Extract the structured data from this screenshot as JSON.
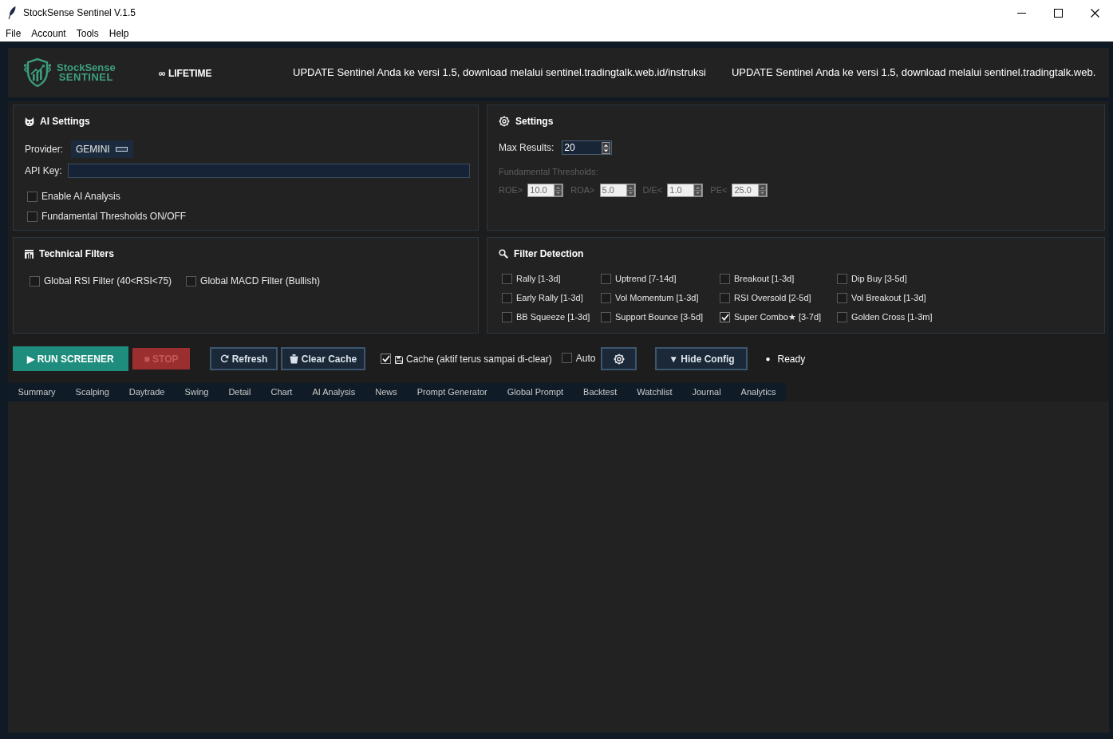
{
  "window": {
    "title": "StockSense Sentinel V.1.5",
    "menu": [
      "File",
      "Account",
      "Tools",
      "Help"
    ]
  },
  "header": {
    "logo": [
      "StockSense",
      "SENTINEL"
    ],
    "license": "∞ LIFETIME",
    "ticker": [
      "UPDATE Sentinel Anda ke versi 1.5, download melalui sentinel.tradingtalk.web.id/instruksi",
      "UPDATE Sentinel Anda ke versi 1.5, download melalui sentinel.tradingtalk.web."
    ]
  },
  "ai_settings": {
    "title": "AI Settings",
    "provider": {
      "label": "Provider:",
      "value": "GEMINI"
    },
    "api_key": {
      "label": "API Key:"
    },
    "options": [
      {
        "label": "Enable AI Analysis",
        "checked": false
      },
      {
        "label": "Fundamental Thresholds ON/OFF",
        "checked": false
      }
    ]
  },
  "settings": {
    "title": "Settings",
    "max_results": {
      "label": "Max Results:",
      "value": "20"
    },
    "thresholds": {
      "label": "Fundamental Thresholds:",
      "disabled": true,
      "fields": [
        {
          "label": "ROE>",
          "value": "10.0"
        },
        {
          "label": "ROA>",
          "value": "5.0"
        },
        {
          "label": "D/E<",
          "value": "1.0"
        },
        {
          "label": "PE<",
          "value": "25.0"
        }
      ]
    }
  },
  "technical_filters": {
    "title": "Technical Filters",
    "options": [
      {
        "label": "Global RSI Filter (40<RSI<75)",
        "checked": false
      },
      {
        "label": "Global MACD Filter (Bullish)",
        "checked": false
      }
    ]
  },
  "filter_detection": {
    "title": "Filter Detection",
    "options": [
      {
        "label": "Rally [1-3d]",
        "checked": false
      },
      {
        "label": "Uptrend [7-14d]",
        "checked": false
      },
      {
        "label": "Breakout [1-3d]",
        "checked": false
      },
      {
        "label": "Dip Buy [3-5d]",
        "checked": false
      },
      {
        "label": "Early Rally [1-3d]",
        "checked": false
      },
      {
        "label": "Vol Momentum [1-3d]",
        "checked": false
      },
      {
        "label": "RSI Oversold [2-5d]",
        "checked": false
      },
      {
        "label": "Vol Breakout [1-3d]",
        "checked": false
      },
      {
        "label": "BB Squeeze [1-3d]",
        "checked": false
      },
      {
        "label": "Support Bounce [3-5d]",
        "checked": false
      },
      {
        "label": "Super Combo★ [3-7d]",
        "checked": true
      },
      {
        "label": "Golden Cross [1-3m]",
        "checked": false
      }
    ]
  },
  "toolbar": {
    "run": {
      "label": "▶ RUN SCREENER"
    },
    "stop": {
      "label": "■ STOP",
      "disabled": true
    },
    "refresh": {
      "label": "Refresh"
    },
    "clear_cache": {
      "label": "Clear Cache"
    },
    "cache": {
      "label": "Cache (aktif terus sampai di-clear)",
      "checked": true
    },
    "auto": {
      "label": "Auto",
      "checked": false
    },
    "hide_config": {
      "label": "▼ Hide Config"
    },
    "status": {
      "dot": "●",
      "text": "Ready"
    }
  },
  "tabs": [
    {
      "label": "Summary",
      "selected": false
    },
    {
      "label": "Scalping",
      "selected": false
    },
    {
      "label": "Daytrade",
      "selected": false
    },
    {
      "label": "Swing",
      "selected": false
    },
    {
      "label": "Detail",
      "selected": false
    },
    {
      "label": "Chart",
      "selected": false
    },
    {
      "label": "AI Analysis",
      "selected": false
    },
    {
      "label": "News",
      "selected": false
    },
    {
      "label": "Prompt Generator",
      "selected": false
    },
    {
      "label": "Global Prompt",
      "selected": false
    },
    {
      "label": "Backtest",
      "selected": false
    },
    {
      "label": "Watchlist",
      "selected": false
    },
    {
      "label": "Journal",
      "selected": false
    },
    {
      "label": "Analytics",
      "selected": false
    }
  ]
}
